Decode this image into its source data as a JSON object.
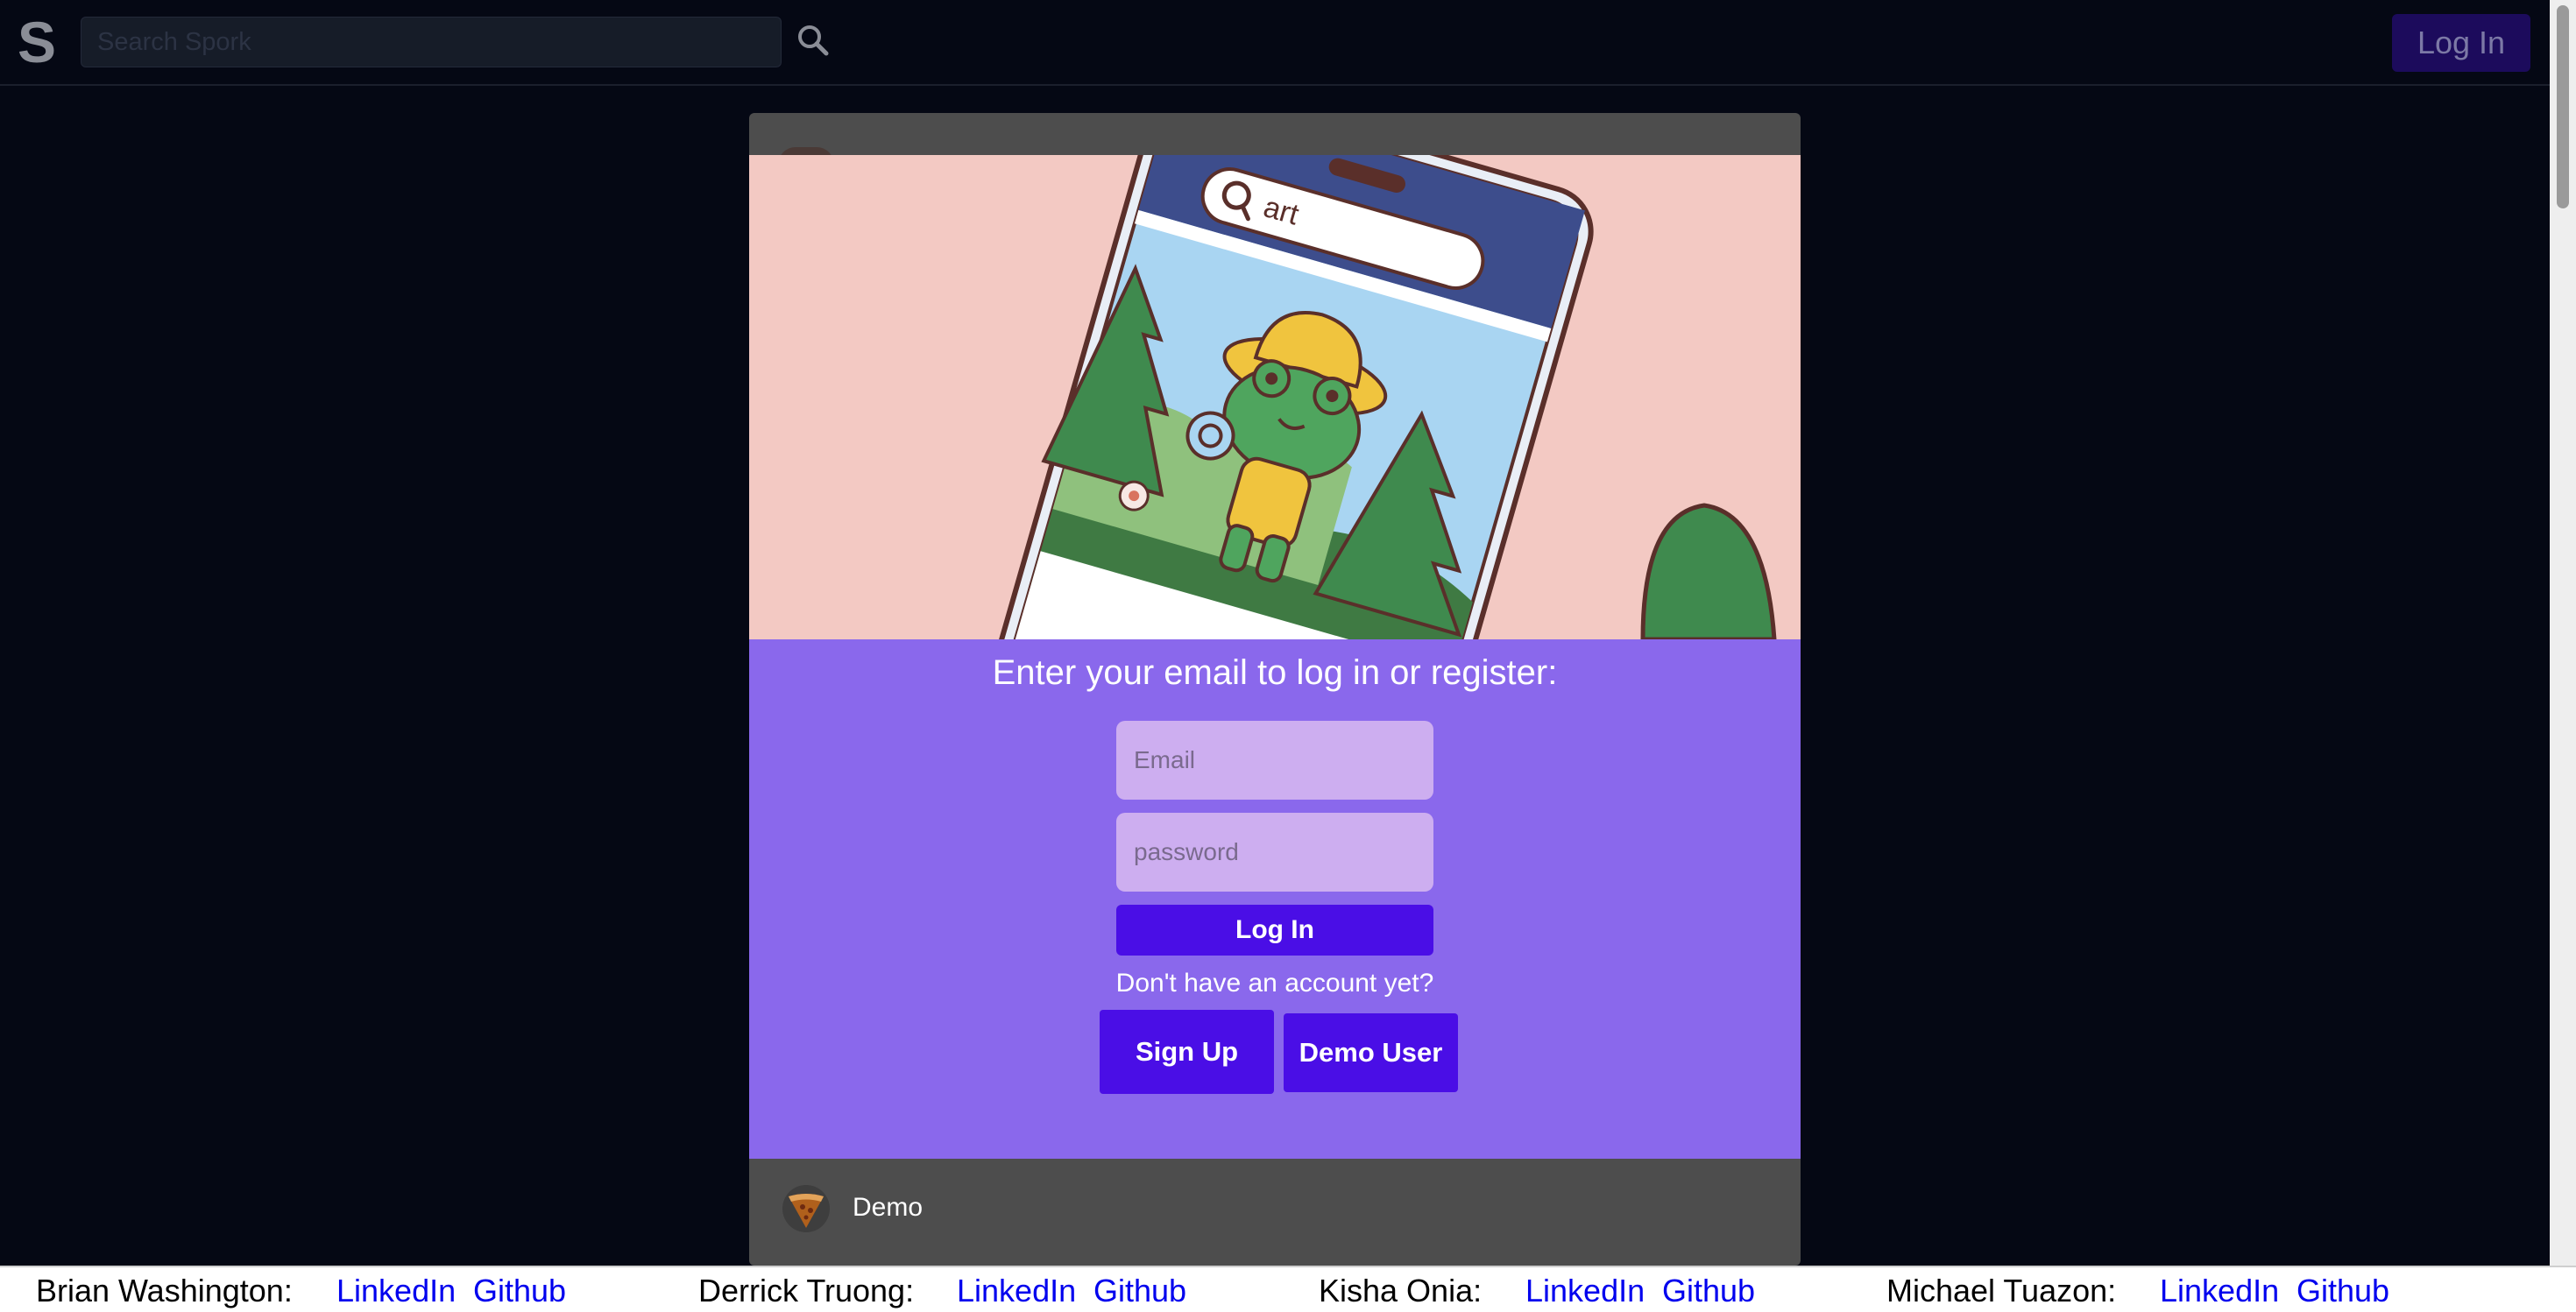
{
  "nav": {
    "logo": "S",
    "search_placeholder": "Search Spork",
    "login_label": "Log In"
  },
  "post": {
    "author": "Demo"
  },
  "modal": {
    "image_search_text": "art",
    "heading": "Enter your email to log in or register:",
    "email_placeholder": "Email",
    "password_placeholder": "password",
    "login_label": "Log In",
    "no_account_text": "Don't have an account yet?",
    "signup_label": "Sign Up",
    "demo_label": "Demo User"
  },
  "footer": {
    "people": [
      {
        "name": "Brian Washington:",
        "linkedin": "LinkedIn",
        "github": "Github"
      },
      {
        "name": "Derrick Truong:",
        "linkedin": "LinkedIn",
        "github": "Github"
      },
      {
        "name": "Kisha Onia:",
        "linkedin": "LinkedIn",
        "github": "Github"
      },
      {
        "name": "Michael Tuazon:",
        "linkedin": "LinkedIn",
        "github": "Github"
      }
    ]
  },
  "colors": {
    "background": "#050814",
    "modal_purple": "#8a68ec",
    "button_indigo": "#4a0ee6",
    "input_lavender": "#cdaef0",
    "illustration_pink": "#f3c9c3",
    "link_blue": "#0000ee"
  },
  "icons": [
    "search-icon",
    "pizza-slice-icon"
  ]
}
